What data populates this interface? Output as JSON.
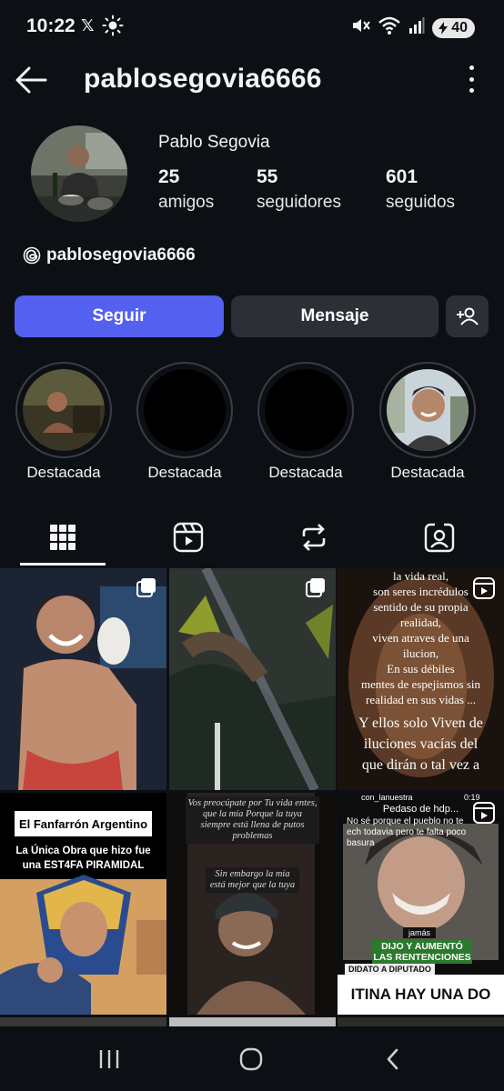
{
  "status_bar": {
    "time": "10:22",
    "x_glyph": "𝕏",
    "battery": "40",
    "icons": [
      "x-icon",
      "sun-icon",
      "mute-icon",
      "wifi-icon",
      "signal-icon",
      "battery-icon"
    ]
  },
  "header": {
    "title": "pablosegovia6666"
  },
  "profile": {
    "name": "Pablo Segovia",
    "stats": [
      {
        "num": "25",
        "label": "amigos"
      },
      {
        "num": "55",
        "label": "seguidores"
      },
      {
        "num": "601",
        "label": "seguidos"
      }
    ],
    "threads_handle": "pablosegovia6666"
  },
  "actions": {
    "follow": "Seguir",
    "message": "Mensaje"
  },
  "highlights": [
    {
      "label": "Destacada"
    },
    {
      "label": "Destacada"
    },
    {
      "label": "Destacada"
    },
    {
      "label": "Destacada"
    }
  ],
  "tabs": [
    "grid-icon",
    "reels-icon",
    "reposts-icon",
    "tagged-icon"
  ],
  "posts": {
    "p3_lines": [
      "la vida real,",
      "son seres  incrédulos",
      "sentido de su propia",
      "realidad,",
      "viven atraves de una",
      "ilucion,",
      "En sus débiles",
      "mentes de espejismos sin",
      "realidad en sus vidas ...",
      "Y ellos solo Viven de",
      "iluciones vacías  del",
      "que dirán o tal vez a"
    ],
    "p4_title": "El Fanfarrón Argentino",
    "p4_sub": "La Única Obra que hizo fue una EST4FA PIRAMIDAL",
    "p5_top": "Vos preocúpate por Tu vida entes, que la mía Porque la tuya siempre está llena de putos problemas",
    "p5_mid": "Sin embargo la mía está mejor que la tuya",
    "p6_user": "con_lanuestra",
    "p6_time": "0:19",
    "p6_line1": "Pedaso de hdp...",
    "p6_line2": "No sé porque el pueblo no te ech todavia pero te falta poco basura",
    "p6_tag": "jamás",
    "p6_green": "DIJO Y AUMENTÓ LAS RENTENCIONES",
    "p6_sub": "DIDATO A DIPUTADO",
    "p6_bottom": "ITINA HAY UNA DO"
  }
}
